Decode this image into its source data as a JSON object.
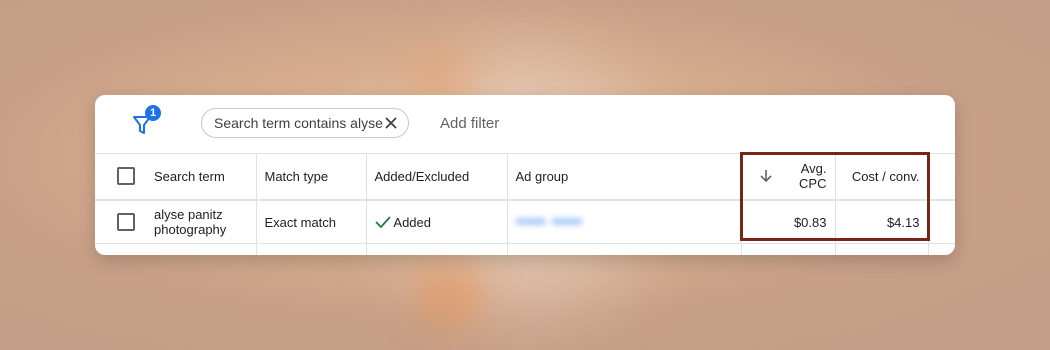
{
  "filter": {
    "badge_count": "1",
    "chip_label": "Search term contains alyse",
    "add_filter_label": "Add filter"
  },
  "table": {
    "columns": [
      {
        "label": "Search term"
      },
      {
        "label": "Match type"
      },
      {
        "label": "Added/Excluded"
      },
      {
        "label": "Ad group"
      },
      {
        "label": "Avg. CPC",
        "sorted": "descending"
      },
      {
        "label": "Cost / conv."
      }
    ],
    "rows": [
      {
        "search_term": "alyse panitz photography",
        "match_type": "Exact match",
        "added_excluded": "Added",
        "ad_group": "blurred",
        "avg_cpc": "$0.83",
        "cost_per_conv": "$4.13"
      }
    ]
  },
  "colors": {
    "accent": "#1a73e8",
    "added_check": "#188038",
    "highlight_border": "#7a2418"
  }
}
